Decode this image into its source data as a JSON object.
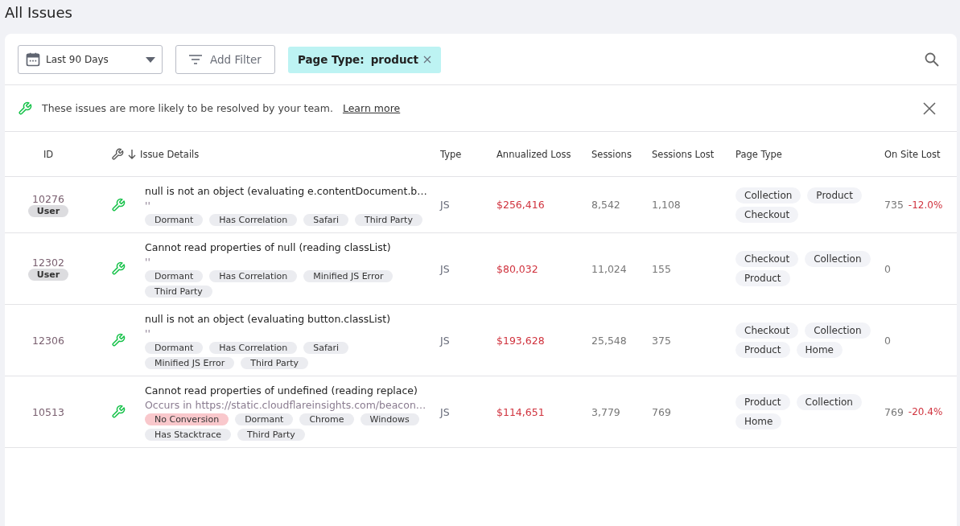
{
  "page_title": "All Issues",
  "toolbar": {
    "date_range": "Last 90 Days",
    "add_filter": "Add Filter",
    "filter_chip": {
      "label": "Page Type:",
      "value": "product"
    }
  },
  "notice": {
    "text": "These issues are more likely to be resolved by your team.",
    "link": "Learn more"
  },
  "table": {
    "columns": [
      "ID",
      "Issue Details",
      "Type",
      "Annualized Loss",
      "Sessions",
      "Sessions Lost",
      "Page Type",
      "On Site Lost"
    ],
    "rows": [
      {
        "id": "10276",
        "badge": "User",
        "title": "null is not an object (evaluating e.contentDocument.b…",
        "subtitle": "''",
        "tags": [
          {
            "label": "Dormant",
            "kind": "plain"
          },
          {
            "label": "Has Correlation",
            "kind": "plain"
          },
          {
            "label": "Safari",
            "kind": "plain"
          },
          {
            "label": "Third Party",
            "kind": "plain"
          }
        ],
        "type": "JS",
        "loss": "$256,416",
        "sessions": "8,542",
        "sessions_lost": "1,108",
        "page_types": [
          "Collection",
          "Product",
          "Checkout"
        ],
        "on_site_lost": "735",
        "on_site_change": "-12.0%"
      },
      {
        "id": "12302",
        "badge": "User",
        "title": "Cannot read properties of null (reading classList)",
        "subtitle": "''",
        "tags": [
          {
            "label": "Dormant",
            "kind": "plain"
          },
          {
            "label": "Has Correlation",
            "kind": "plain"
          },
          {
            "label": "Minified JS Error",
            "kind": "plain"
          },
          {
            "label": "Third Party",
            "kind": "plain"
          }
        ],
        "type": "JS",
        "loss": "$80,032",
        "sessions": "11,024",
        "sessions_lost": "155",
        "page_types": [
          "Checkout",
          "Collection",
          "Product"
        ],
        "on_site_lost": "0"
      },
      {
        "id": "12306",
        "title": "null is not an object (evaluating button.classList)",
        "subtitle": "''",
        "tags": [
          {
            "label": "Dormant",
            "kind": "plain"
          },
          {
            "label": "Has Correlation",
            "kind": "plain"
          },
          {
            "label": "Safari",
            "kind": "plain"
          },
          {
            "label": "Minified JS Error",
            "kind": "plain"
          },
          {
            "label": "Third Party",
            "kind": "plain"
          }
        ],
        "type": "JS",
        "loss": "$193,628",
        "sessions": "25,548",
        "sessions_lost": "375",
        "page_types": [
          "Checkout",
          "Collection",
          "Product",
          "Home"
        ],
        "on_site_lost": "0"
      },
      {
        "id": "10513",
        "title": "Cannot read properties of undefined (reading replace)",
        "subtitle": "Occurs in https://static.cloudflareinsights.com/beacon…",
        "tags": [
          {
            "label": "No Conversion",
            "kind": "alert"
          },
          {
            "label": "Dormant",
            "kind": "plain"
          },
          {
            "label": "Chrome",
            "kind": "plain"
          },
          {
            "label": "Windows",
            "kind": "plain"
          },
          {
            "label": "Has Stacktrace",
            "kind": "plain"
          },
          {
            "label": "Third Party",
            "kind": "plain"
          }
        ],
        "type": "JS",
        "loss": "$114,651",
        "sessions": "3,779",
        "sessions_lost": "769",
        "page_types": [
          "Product",
          "Collection",
          "Home"
        ],
        "on_site_lost": "769",
        "on_site_change": "-20.4%"
      }
    ]
  }
}
